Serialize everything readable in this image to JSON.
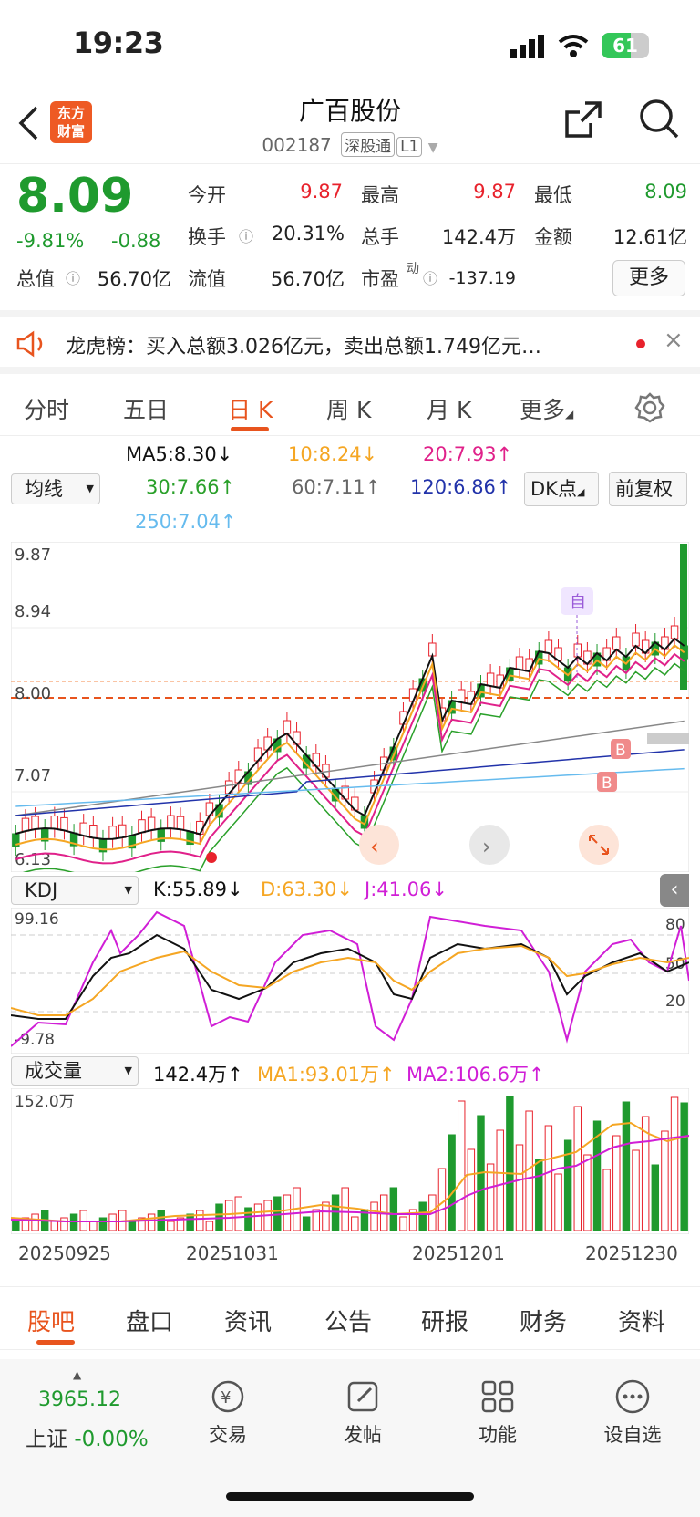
{
  "status_bar": {
    "time": "19:23",
    "battery": "61"
  },
  "header": {
    "logo_line1": "东方",
    "logo_line2": "财富",
    "title": "广百股份",
    "code": "002187",
    "tag1": "深股通",
    "tag2": "L1"
  },
  "quote": {
    "price": "8.09",
    "change_pct": "-9.81%",
    "change_abs": "-0.88",
    "open_label": "今开",
    "open": "9.87",
    "high_label": "最高",
    "high": "9.87",
    "low_label": "最低",
    "low": "8.09",
    "turnover_label": "换手",
    "turnover": "20.31%",
    "volume_label": "总手",
    "volume": "142.4万",
    "amount_label": "金额",
    "amount": "12.61亿",
    "mktcap_label": "总值",
    "mktcap": "56.70亿",
    "float_label": "流值",
    "float_cap": "56.70亿",
    "pe_label": "市盈",
    "pe_sup": "动",
    "pe": "-137.19",
    "more": "更多"
  },
  "notice": {
    "text": "龙虎榜：买入总额3.026亿元，卖出总额1.749亿元…"
  },
  "tabs": [
    "分时",
    "五日",
    "日 K",
    "周 K",
    "月 K",
    "更多"
  ],
  "active_tab": "日 K",
  "ma": {
    "selector": "均线",
    "ma5": "MA5:8.30↓",
    "ma10": "10:8.24↓",
    "ma20": "20:7.93↑",
    "ma30": "30:7.66↑",
    "ma60": "60:7.11↑",
    "ma120": "120:6.86↑",
    "ma250": "250:7.04↑",
    "dk": "DK点",
    "fq": "前复权"
  },
  "colors": {
    "up": "#e8222c",
    "down": "#1f9a2e",
    "ma5": "#111111",
    "ma10": "#f5a623",
    "ma20": "#e0218a",
    "ma30": "#2aa02a",
    "ma60": "#888888",
    "ma120": "#2233aa",
    "ma250": "#66bbee",
    "accent": "#e8541e"
  },
  "kline": {
    "price_labels": [
      "9.87",
      "8.94",
      "8.00",
      "7.07",
      "6.13"
    ],
    "marker_zi": "自",
    "marker_b": "B"
  },
  "kdj": {
    "selector": "KDJ",
    "k": "K:55.89↓",
    "d": "D:63.30↓",
    "j": "J:41.06↓",
    "top": "99.16",
    "bottom": "-9.78",
    "levels": [
      "80",
      "50",
      "20"
    ]
  },
  "vol": {
    "selector": "成交量",
    "value": "142.4万↑",
    "ma1": "MA1:93.01万↑",
    "ma2": "MA2:106.6万↑",
    "max": "152.0万"
  },
  "dates": [
    "20250925",
    "20251031",
    "20251201",
    "20251230"
  ],
  "bottom_tabs": [
    "股吧",
    "盘口",
    "资讯",
    "公告",
    "研报",
    "财务",
    "资料"
  ],
  "active_bottom_tab": "股吧",
  "footer": {
    "index_value": "3965.12",
    "index_name": "上证",
    "index_change": "-0.00%",
    "items": [
      "交易",
      "发帖",
      "功能",
      "设自选"
    ]
  }
}
